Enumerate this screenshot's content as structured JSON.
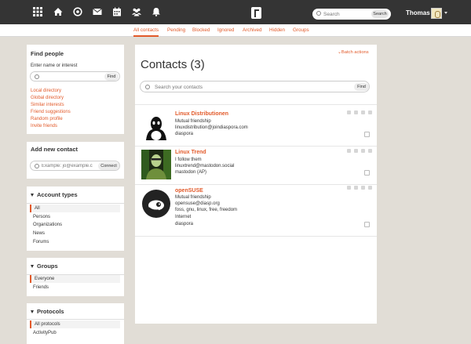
{
  "topnav": {
    "icons": [
      "grid-icon",
      "home-icon",
      "at-icon",
      "mail-icon",
      "calendar-icon",
      "people-icon",
      "bell-icon"
    ],
    "logo": "friendica-logo",
    "search_placeholder": "Search",
    "search_button": "Search",
    "user_name": "Thomas"
  },
  "tabs": [
    {
      "label": "All contacts",
      "active": true
    },
    {
      "label": "Pending"
    },
    {
      "label": "Blocked"
    },
    {
      "label": "Ignored"
    },
    {
      "label": "Archived"
    },
    {
      "label": "Hidden"
    },
    {
      "label": "Groups"
    }
  ],
  "sidebar": {
    "find_people": {
      "title": "Find people",
      "label": "Enter name or interest",
      "button": "Find",
      "links": [
        "Local directory",
        "Global directory",
        "Similar interests",
        "Friend suggestions",
        "Random profile",
        "Invite friends"
      ]
    },
    "add_contact": {
      "title": "Add new contact",
      "placeholder": "Example: jo@example.c",
      "button": "Connect"
    },
    "account_types": {
      "title": "Account types",
      "items": [
        "All",
        "Persons",
        "Organizations",
        "News",
        "Forums"
      ],
      "selected": "All"
    },
    "groups": {
      "title": "Groups",
      "items": [
        "Everyone",
        "Friends"
      ],
      "selected": "Everyone"
    },
    "protocols": {
      "title": "Protocols",
      "items": [
        "All protocols",
        "ActivityPub"
      ],
      "selected": "All protocols"
    }
  },
  "main": {
    "title": "Contacts (3)",
    "batch_actions": "Batch actions",
    "search_placeholder": "Search your contacts",
    "search_button": "Find",
    "contacts": [
      {
        "name": "Linux Distributionen",
        "lines": [
          "Mutual friendship",
          "linuxdistribution@joindiaspora.com",
          "diaspora"
        ]
      },
      {
        "name": "Linux Trend",
        "lines": [
          "I follow them",
          "linuxtrend@mastodon.social",
          "mastodon (AP)"
        ]
      },
      {
        "name": "openSUSE",
        "lines": [
          "Mutual friendship",
          "opensuse@diasp.org",
          "foss, gnu, linux, free, freedom",
          "Internet",
          "diaspora"
        ]
      }
    ]
  },
  "colors": {
    "accent": "#e25a2a",
    "topbar": "#343434",
    "background": "#e1ddd6"
  }
}
